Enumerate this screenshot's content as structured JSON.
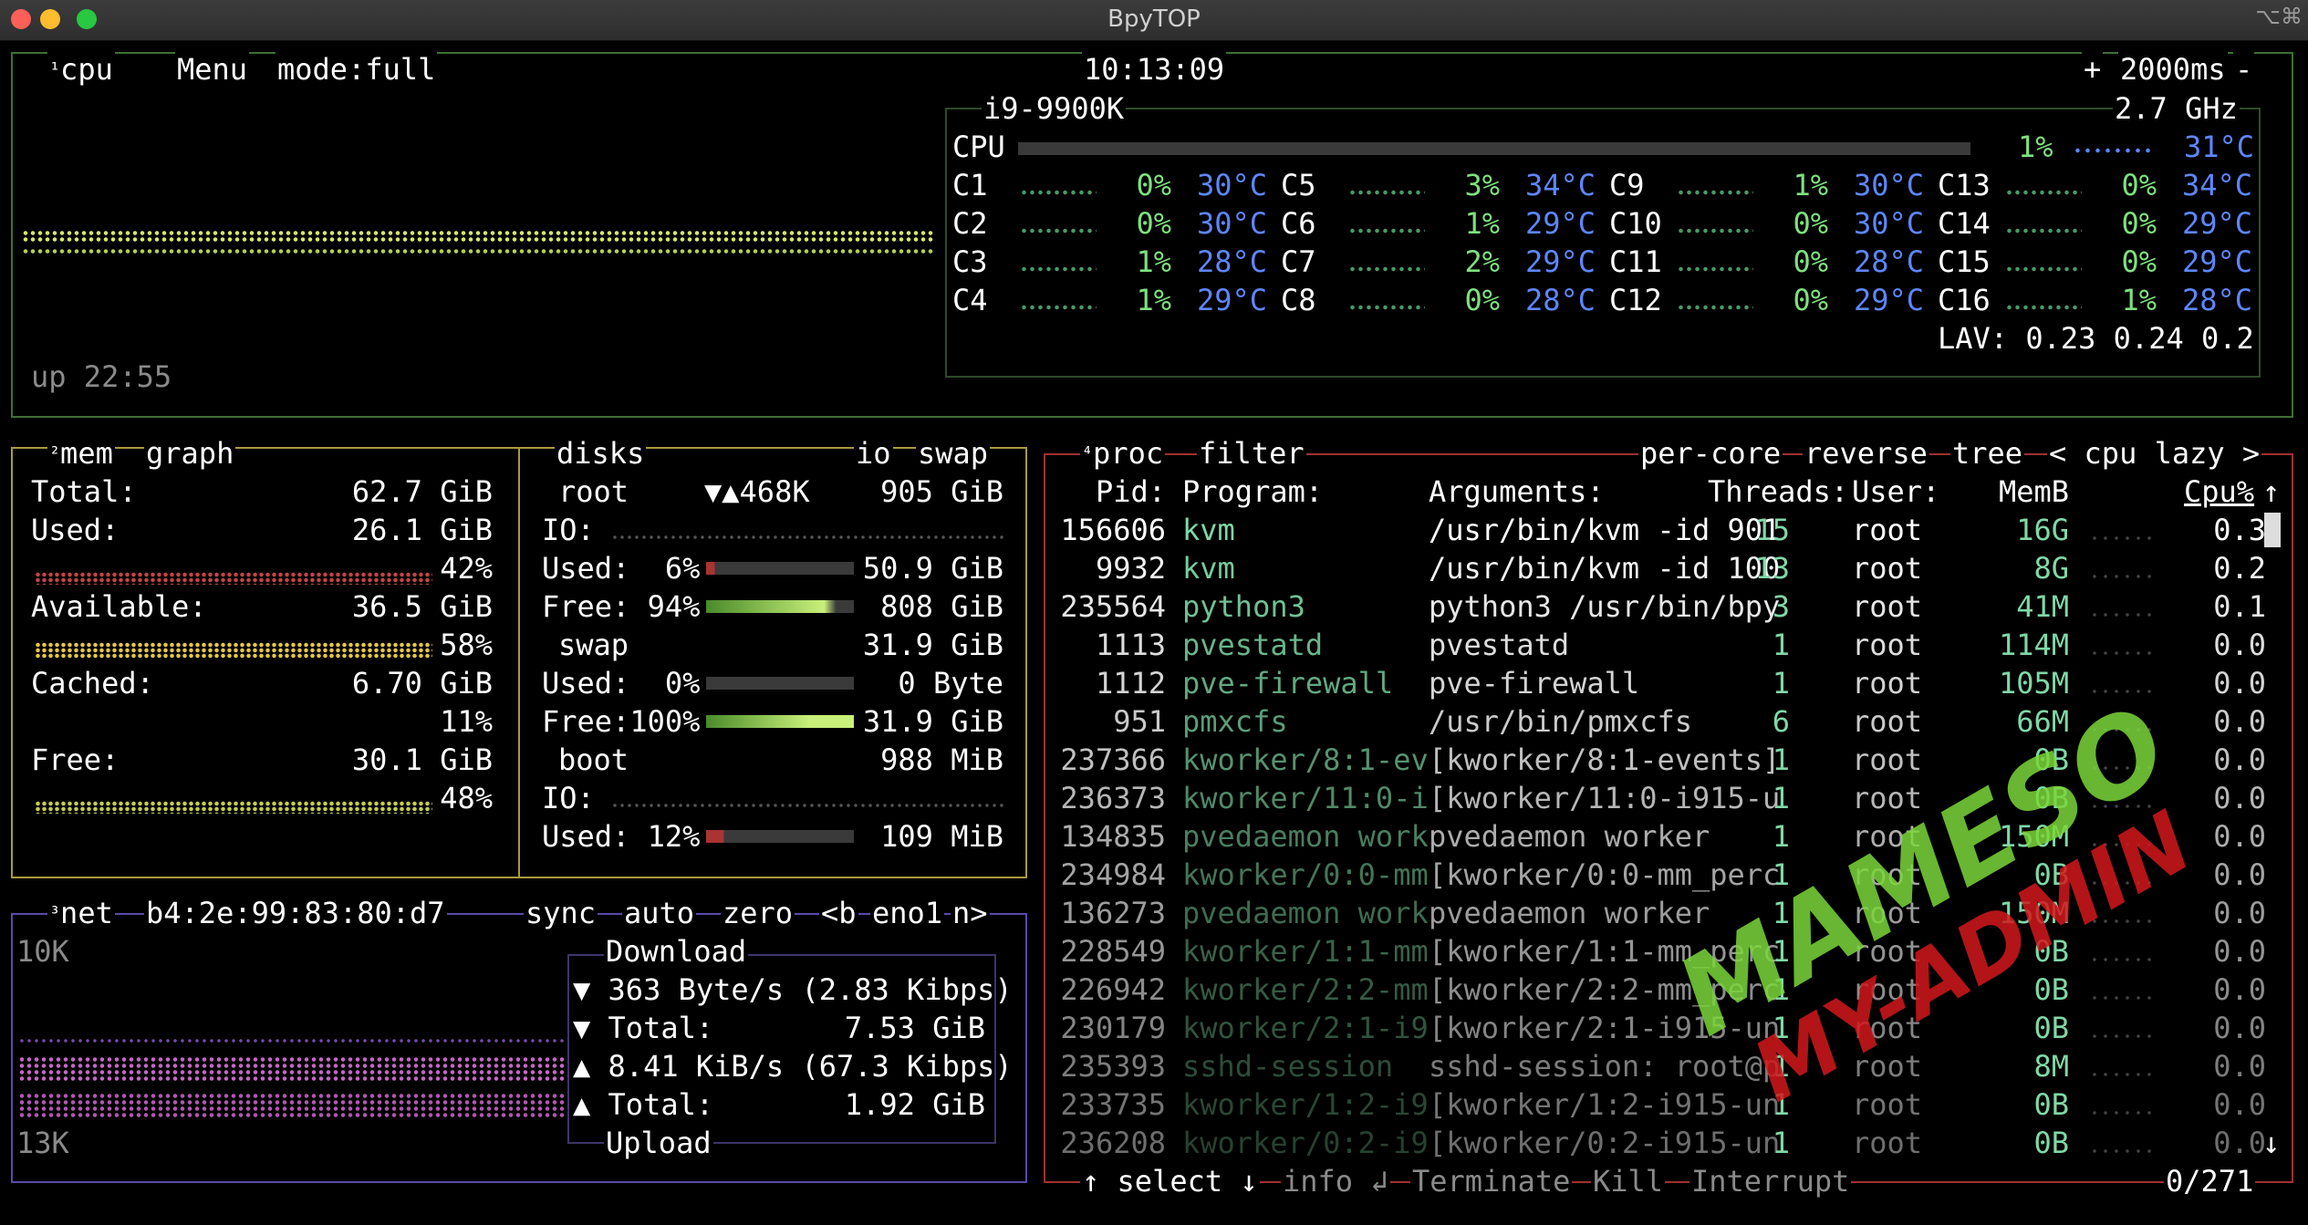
{
  "window": {
    "title": "BpyTOP",
    "shortcut": "⌥⌘"
  },
  "cpu": {
    "num": "¹",
    "label": "cpu",
    "menu": "Menu",
    "mode": "mode:full",
    "clock": "10:13:09",
    "interval_plus": "+",
    "interval": "2000ms",
    "interval_minus": "-",
    "model": "i9-9900K",
    "freq": "2.7 GHz",
    "total_label": "CPU",
    "total_pct": "1%",
    "total_temp": "31°C",
    "uptime": "up 22:55",
    "lav": "LAV: 0.23 0.24 0.2",
    "cores": [
      {
        "n": "C1",
        "p": "0%",
        "t": "30°C"
      },
      {
        "n": "C2",
        "p": "0%",
        "t": "30°C"
      },
      {
        "n": "C3",
        "p": "1%",
        "t": "28°C"
      },
      {
        "n": "C4",
        "p": "1%",
        "t": "29°C"
      },
      {
        "n": "C5",
        "p": "3%",
        "t": "34°C"
      },
      {
        "n": "C6",
        "p": "1%",
        "t": "29°C"
      },
      {
        "n": "C7",
        "p": "2%",
        "t": "29°C"
      },
      {
        "n": "C8",
        "p": "0%",
        "t": "28°C"
      },
      {
        "n": "C9",
        "p": "1%",
        "t": "30°C"
      },
      {
        "n": "C10",
        "p": "0%",
        "t": "30°C"
      },
      {
        "n": "C11",
        "p": "0%",
        "t": "28°C"
      },
      {
        "n": "C12",
        "p": "0%",
        "t": "29°C"
      },
      {
        "n": "C13",
        "p": "0%",
        "t": "34°C"
      },
      {
        "n": "C14",
        "p": "0%",
        "t": "29°C"
      },
      {
        "n": "C15",
        "p": "0%",
        "t": "29°C"
      },
      {
        "n": "C16",
        "p": "1%",
        "t": "28°C"
      }
    ]
  },
  "mem": {
    "num": "²",
    "label": "mem",
    "graph": "graph",
    "total_l": "Total:",
    "total_v": "62.7 GiB",
    "used_l": "Used:",
    "used_v": "26.1 GiB",
    "used_p": "42%",
    "avail_l": "Available:",
    "avail_v": "36.5 GiB",
    "avail_p": "58%",
    "cached_l": "Cached:",
    "cached_v": "6.70 GiB",
    "cached_p": "11%",
    "free_l": "Free:",
    "free_v": "30.1 GiB",
    "free_p": "48%"
  },
  "disks": {
    "label": "disks",
    "io": "io",
    "swap": "swap",
    "root": "root",
    "root_io": "▼▲468K",
    "root_size": "905 GiB",
    "io_l": "IO:",
    "used_l": "Used:",
    "free_l": "Free:",
    "root_used_p": "6%",
    "root_used_v": "50.9 GiB",
    "root_free_p": "94%",
    "root_free_v": "808 GiB",
    "swap_name": "swap",
    "swap_size": "31.9 GiB",
    "swap_used_p": "0%",
    "swap_used_v": "0 Byte",
    "swap_free_l": "Free:100%",
    "swap_free_v": "31.9 GiB",
    "boot": "boot",
    "boot_size": "988 MiB",
    "boot_used_p": "12%",
    "boot_used_v": "109 MiB"
  },
  "net": {
    "num": "³",
    "label": "net",
    "mac": "b4:2e:99:83:80:d7",
    "sync": "sync",
    "auto": "auto",
    "zero": "zero",
    "prev": "<b",
    "iface": "eno1",
    "next": "n>",
    "top_scale": "10K",
    "bottom_scale": "13K",
    "download": "Download",
    "dl_rate": "▼ 363 Byte/s (2.83 Kibps)",
    "dl_total_l": "▼ Total:",
    "dl_total_v": "7.53 GiB",
    "ul_rate": "▲ 8.41 KiB/s (67.3 Kibps)",
    "ul_total_l": "▲ Total:",
    "ul_total_v": "1.92 GiB",
    "upload": "Upload"
  },
  "proc": {
    "num": "⁴",
    "label": "proc",
    "filter": "filter",
    "percore": "per-core",
    "reverse": "reverse",
    "tree": "tree",
    "sort": "< cpu lazy >",
    "headers": {
      "pid": "Pid:",
      "program": "Program:",
      "args": "Arguments:",
      "threads": "Threads:",
      "user": "User:",
      "mem": "MemB",
      "cpu": "Cpu%"
    },
    "up_arrow": "↑",
    "down_arrow": "↓",
    "rows": [
      {
        "pid": "156606",
        "prog": "kvm",
        "args": "/usr/bin/kvm -id 901",
        "thr": "15",
        "user": "root",
        "mem": "16G",
        "cpu": "0.3"
      },
      {
        "pid": "9932",
        "prog": "kvm",
        "args": "/usr/bin/kvm -id 100",
        "thr": "13",
        "user": "root",
        "mem": "8G",
        "cpu": "0.2"
      },
      {
        "pid": "235564",
        "prog": "python3",
        "args": "python3 /usr/bin/bpy",
        "thr": "3",
        "user": "root",
        "mem": "41M",
        "cpu": "0.1"
      },
      {
        "pid": "1113",
        "prog": "pvestatd",
        "args": "pvestatd",
        "thr": "1",
        "user": "root",
        "mem": "114M",
        "cpu": "0.0"
      },
      {
        "pid": "1112",
        "prog": "pve-firewall",
        "args": "pve-firewall",
        "thr": "1",
        "user": "root",
        "mem": "105M",
        "cpu": "0.0"
      },
      {
        "pid": "951",
        "prog": "pmxcfs",
        "args": "/usr/bin/pmxcfs",
        "thr": "6",
        "user": "root",
        "mem": "66M",
        "cpu": "0.0"
      },
      {
        "pid": "237366",
        "prog": "kworker/8:1-ev",
        "args": "[kworker/8:1-events]",
        "thr": "1",
        "user": "root",
        "mem": "0B",
        "cpu": "0.0"
      },
      {
        "pid": "236373",
        "prog": "kworker/11:0-i",
        "args": "[kworker/11:0-i915-u",
        "thr": "1",
        "user": "root",
        "mem": "0B",
        "cpu": "0.0"
      },
      {
        "pid": "134835",
        "prog": "pvedaemon work",
        "args": "pvedaemon worker",
        "thr": "1",
        "user": "root",
        "mem": "150M",
        "cpu": "0.0"
      },
      {
        "pid": "234984",
        "prog": "kworker/0:0-mm",
        "args": "[kworker/0:0-mm_perc",
        "thr": "1",
        "user": "root",
        "mem": "0B",
        "cpu": "0.0"
      },
      {
        "pid": "136273",
        "prog": "pvedaemon work",
        "args": "pvedaemon worker",
        "thr": "1",
        "user": "root",
        "mem": "150M",
        "cpu": "0.0"
      },
      {
        "pid": "228549",
        "prog": "kworker/1:1-mm",
        "args": "[kworker/1:1-mm_perc",
        "thr": "1",
        "user": "root",
        "mem": "0B",
        "cpu": "0.0"
      },
      {
        "pid": "226942",
        "prog": "kworker/2:2-mm",
        "args": "[kworker/2:2-mm_perc",
        "thr": "1",
        "user": "root",
        "mem": "0B",
        "cpu": "0.0"
      },
      {
        "pid": "230179",
        "prog": "kworker/2:1-i9",
        "args": "[kworker/2:1-i915-un",
        "thr": "1",
        "user": "root",
        "mem": "0B",
        "cpu": "0.0"
      },
      {
        "pid": "235393",
        "prog": "sshd-session",
        "args": "sshd-session: root@p",
        "thr": "1",
        "user": "root",
        "mem": "8M",
        "cpu": "0.0"
      },
      {
        "pid": "233735",
        "prog": "kworker/1:2-i9",
        "args": "[kworker/1:2-i915-un",
        "thr": "1",
        "user": "root",
        "mem": "0B",
        "cpu": "0.0"
      },
      {
        "pid": "236208",
        "prog": "kworker/0:2-i9",
        "args": "[kworker/0:2-i915-un",
        "thr": "1",
        "user": "root",
        "mem": "0B",
        "cpu": "0.0"
      }
    ],
    "select": "↑ select ↓",
    "info": "info ↲",
    "terminate": "Terminate",
    "kill": "Kill",
    "interrupt": "Interrupt",
    "count": "0/271"
  },
  "watermark": {
    "line1": "MAMESO",
    "line2": "MY-ADMIN"
  }
}
